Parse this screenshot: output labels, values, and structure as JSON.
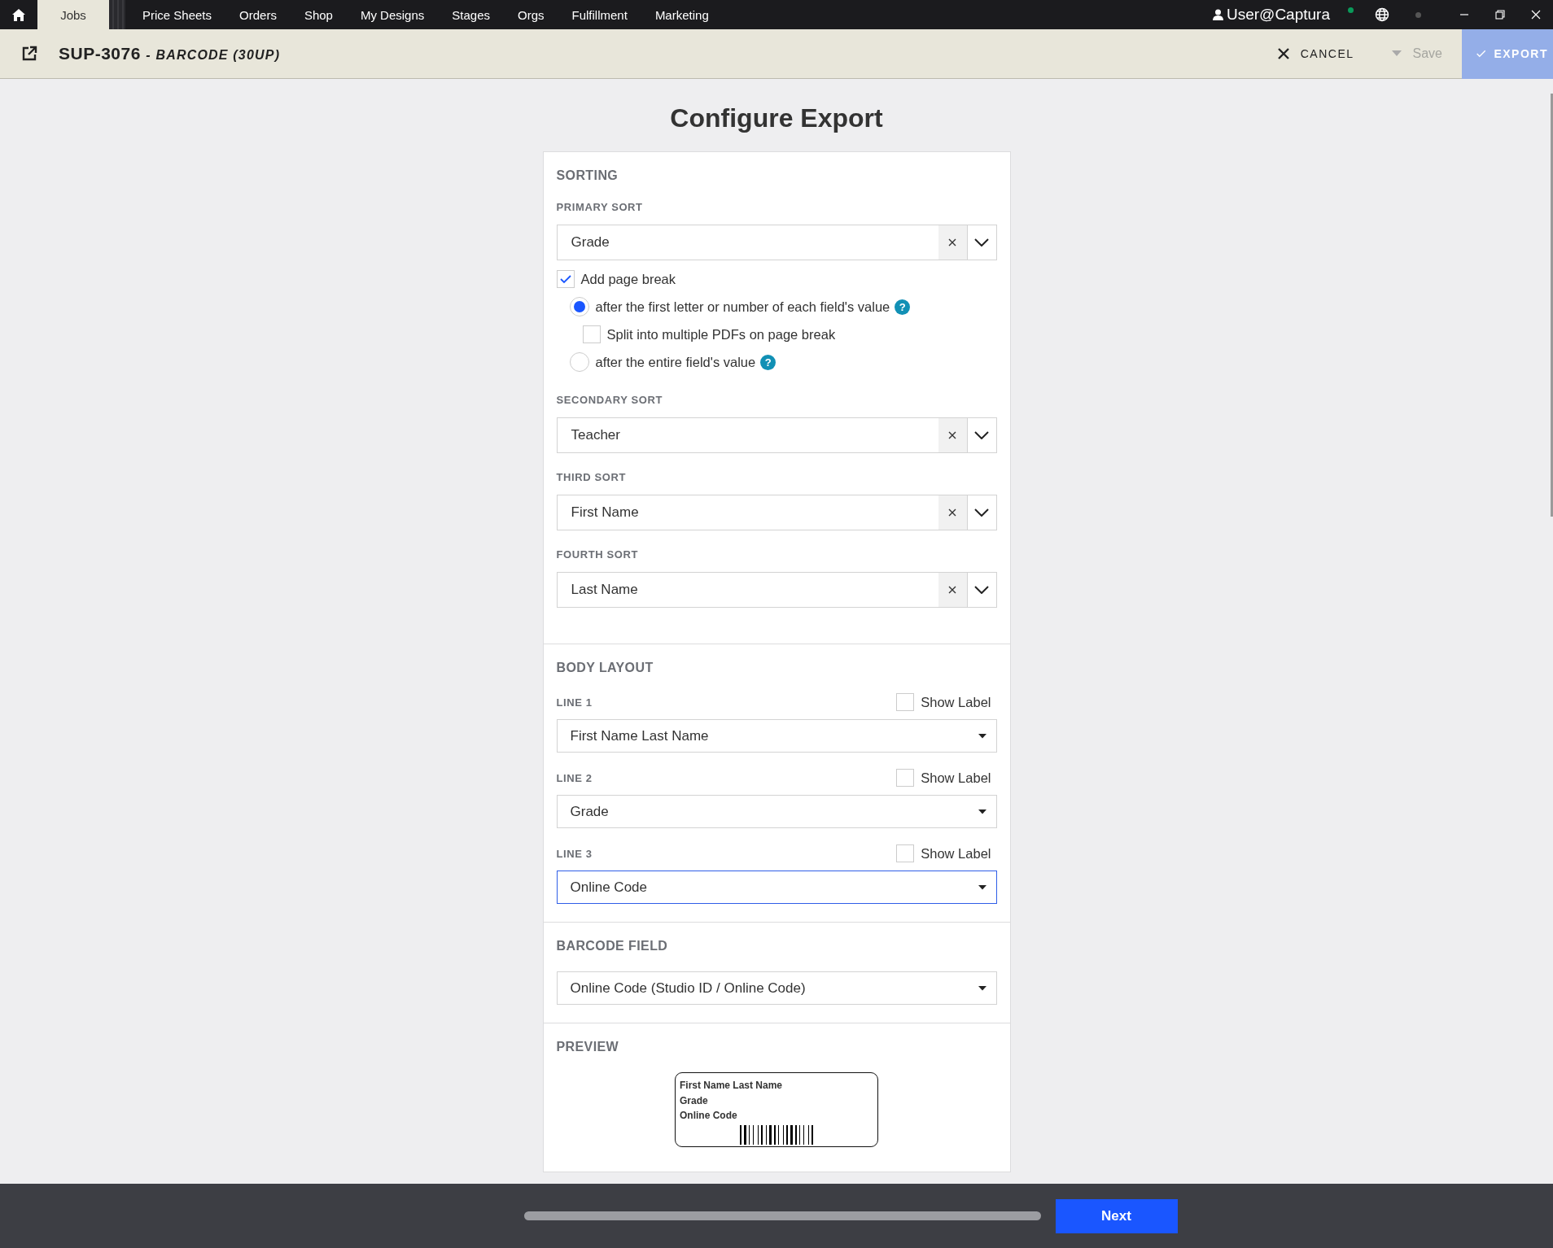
{
  "nav": {
    "items": [
      {
        "label": "Jobs",
        "selected": true
      },
      {
        "label": "Price Sheets",
        "selected": false
      },
      {
        "label": "Orders",
        "selected": false
      },
      {
        "label": "Shop",
        "selected": false
      },
      {
        "label": "My Designs",
        "selected": false
      },
      {
        "label": "Stages",
        "selected": false
      },
      {
        "label": "Orgs",
        "selected": false
      },
      {
        "label": "Fulfillment",
        "selected": false
      },
      {
        "label": "Marketing",
        "selected": false
      }
    ],
    "user": "User@Captura"
  },
  "header": {
    "job_id": "SUP-3076",
    "job_name": "- BARCODE (30UP)",
    "cancel": "CANCEL",
    "save": {
      "label": "Save",
      "disabled": true
    },
    "export": {
      "label": "EXPORT",
      "disabled": true
    }
  },
  "title": "Configure Export",
  "sorting": {
    "heading": "SORTING",
    "sorts": [
      {
        "label": "PRIMARY SORT",
        "value": "Grade"
      },
      {
        "label": "SECONDARY SORT",
        "value": "Teacher"
      },
      {
        "label": "THIRD SORT",
        "value": "First Name"
      },
      {
        "label": "FOURTH SORT",
        "value": "Last Name"
      }
    ],
    "page_break": {
      "label": "Add page break",
      "checked": true,
      "options": [
        {
          "label": "after the first letter or number of each field's value",
          "selected": true,
          "help": "?"
        },
        {
          "label": "after the entire field's value",
          "selected": false,
          "help": "?"
        }
      ],
      "split": {
        "label": "Split into multiple PDFs on page break",
        "checked": false
      }
    }
  },
  "body_layout": {
    "heading": "BODY LAYOUT",
    "lines": [
      {
        "label": "LINE 1",
        "show_label": {
          "label": "Show Label",
          "checked": false
        },
        "value": "First Name Last Name",
        "focused": false
      },
      {
        "label": "LINE 2",
        "show_label": {
          "label": "Show Label",
          "checked": false
        },
        "value": "Grade",
        "focused": false
      },
      {
        "label": "LINE 3",
        "show_label": {
          "label": "Show Label",
          "checked": false
        },
        "value": "Online Code",
        "focused": true
      }
    ]
  },
  "barcode_field": {
    "heading": "BARCODE FIELD",
    "value": "Online Code (Studio ID / Online Code)"
  },
  "preview": {
    "heading": "PREVIEW",
    "lines": [
      "First Name Last Name",
      "Grade",
      "Online Code"
    ]
  },
  "footer": {
    "next": "Next"
  }
}
